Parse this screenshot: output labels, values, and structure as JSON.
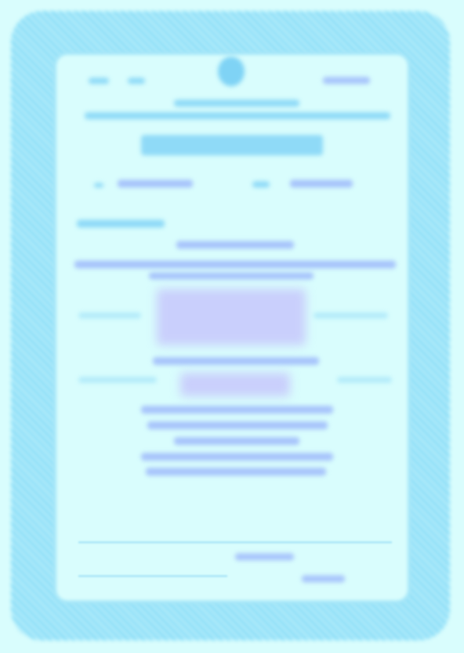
{
  "colors": {
    "background": "#d9fdfd",
    "border": "#7fd9f6",
    "heading_text": "#8fdaf7",
    "filled_text": "#a7c4fb",
    "stamp_tint": "#c9cffc"
  }
}
